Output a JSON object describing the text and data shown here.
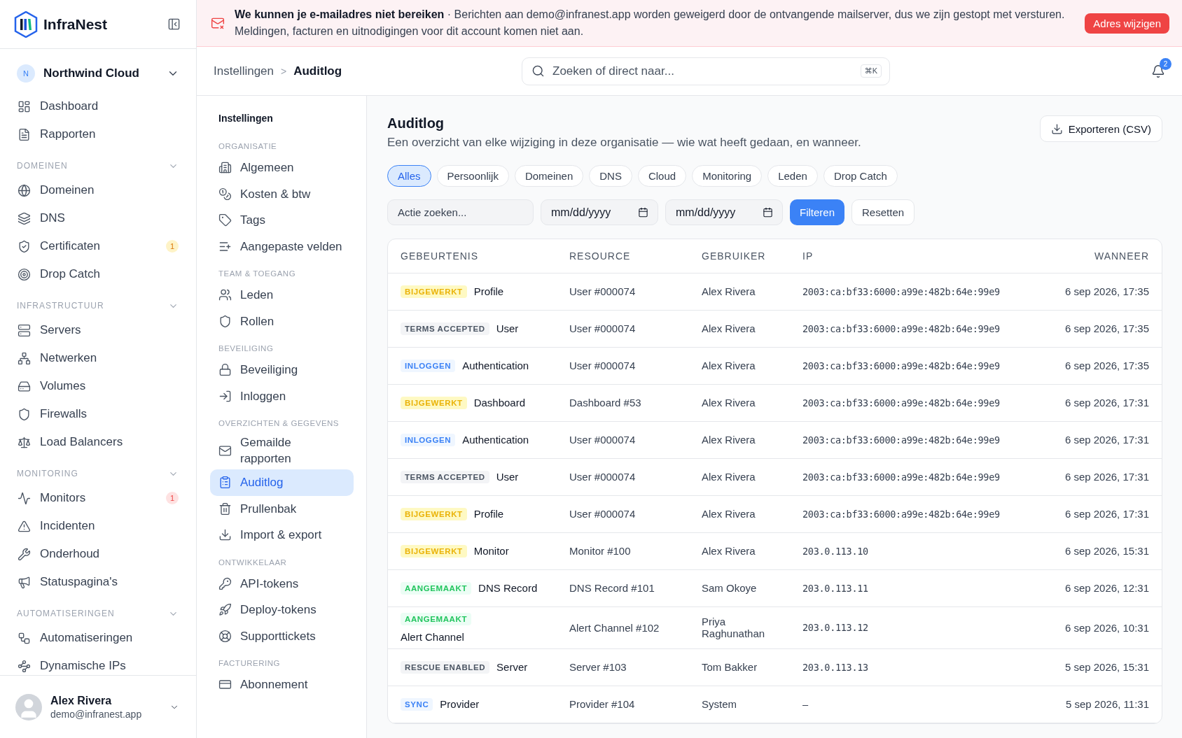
{
  "sidebar": {
    "brand": "InfraNest",
    "org": {
      "initial": "N",
      "name": "Northwind Cloud"
    },
    "top_items": [
      {
        "label": "Dashboard"
      },
      {
        "label": "Rapporten"
      }
    ],
    "sections": [
      {
        "title": "DOMEINEN",
        "items": [
          {
            "label": "Domeinen"
          },
          {
            "label": "DNS"
          },
          {
            "label": "Certificaten",
            "badge": "1",
            "kind": "warning"
          },
          {
            "label": "Drop Catch"
          }
        ]
      },
      {
        "title": "INFRASTRUCTUUR",
        "items": [
          {
            "label": "Servers"
          },
          {
            "label": "Netwerken"
          },
          {
            "label": "Volumes"
          },
          {
            "label": "Firewalls"
          },
          {
            "label": "Load Balancers"
          }
        ]
      },
      {
        "title": "MONITORING",
        "items": [
          {
            "label": "Monitors",
            "badge": "1",
            "kind": "danger"
          },
          {
            "label": "Incidenten"
          },
          {
            "label": "Onderhoud"
          },
          {
            "label": "Statuspagina's"
          }
        ]
      },
      {
        "title": "AUTOMATISERINGEN",
        "items": [
          {
            "label": "Automatiseringen"
          },
          {
            "label": "Dynamische IPs"
          }
        ]
      }
    ],
    "user": {
      "name": "Alex Rivera",
      "email": "demo@infranest.app"
    }
  },
  "banner": {
    "message": "**We kunnen je e-mailadres niet bereiken** · Berichten aan demo@infranest.app worden geweigerd door de ontvangende mailserver, dus we zijn gestopt met versturen. Meldingen, facturen en uitnodigingen voor dit account komen niet aan.",
    "button": "Adres wijzigen"
  },
  "header": {
    "breadcrumb": [
      "Instellingen",
      "Auditlog"
    ],
    "separator": ">",
    "search": {
      "placeholder": "Zoeken of direct naar...",
      "shortcut": "⌘K"
    },
    "notifications": "2"
  },
  "settings_nav": {
    "title": "Instellingen",
    "groups": [
      {
        "title": "ORGANISATIE",
        "items": [
          {
            "label": "Algemeen",
            "selected": false
          },
          {
            "label": "Kosten & btw",
            "selected": false
          },
          {
            "label": "Tags",
            "selected": false
          },
          {
            "label": "Aangepaste velden",
            "selected": false
          }
        ]
      },
      {
        "title": "TEAM & TOEGANG",
        "items": [
          {
            "label": "Leden",
            "selected": false
          },
          {
            "label": "Rollen",
            "selected": false
          }
        ]
      },
      {
        "title": "BEVEILIGING",
        "items": [
          {
            "label": "Beveiliging",
            "selected": false
          },
          {
            "label": "Inloggen",
            "selected": false
          }
        ]
      },
      {
        "title": "OVERZICHTEN & GEGEVENS",
        "items": [
          {
            "label": "Gemailde rapporten",
            "selected": false
          },
          {
            "label": "Auditlog",
            "selected": true
          },
          {
            "label": "Prullenbak",
            "selected": false
          },
          {
            "label": "Import & export",
            "selected": false
          }
        ]
      },
      {
        "title": "ONTWIKKELAAR",
        "items": [
          {
            "label": "API-tokens",
            "selected": false
          },
          {
            "label": "Deploy-tokens",
            "selected": false
          },
          {
            "label": "Supporttickets",
            "selected": false
          }
        ]
      },
      {
        "title": "FACTURERING",
        "items": [
          {
            "label": "Abonnement",
            "selected": false
          }
        ]
      }
    ]
  },
  "page": {
    "title": "Auditlog",
    "subtitle": "Een overzicht van elke wijziging in deze organisatie — wie wat heeft gedaan, en wanneer.",
    "export_button": "Exporteren (CSV)",
    "filters": [
      {
        "label": "Alles",
        "selected": true
      },
      {
        "label": "Persoonlijk",
        "selected": false
      },
      {
        "label": "Domeinen",
        "selected": false
      },
      {
        "label": "DNS",
        "selected": false
      },
      {
        "label": "Cloud",
        "selected": false
      },
      {
        "label": "Monitoring",
        "selected": false
      },
      {
        "label": "Leden",
        "selected": false
      },
      {
        "label": "Drop Catch",
        "selected": false
      }
    ],
    "search": {
      "placeholder": "Actie zoeken..."
    },
    "date_from": {
      "placeholder": "mm/dd/yyyy"
    },
    "date_to": {
      "placeholder": "mm/dd/yyyy"
    },
    "filter_button": "Filteren",
    "reset_button": "Resetten"
  },
  "table": {
    "columns": [
      "GEBEURTENIS",
      "RESOURCE",
      "GEBRUIKER",
      "IP",
      "WANNEER"
    ],
    "rows": [
      {
        "tag": "BIJGEWERKT",
        "kind": "updated",
        "event": "Profile",
        "resource": "User #000074",
        "user": "Alex Rivera",
        "ip": "2003:ca:bf33:6000:a99e:482b:64e:99e9",
        "when": "6 sep 2026, 17:35"
      },
      {
        "tag": "TERMS ACCEPTED",
        "kind": "neutral",
        "event": "User",
        "resource": "User #000074",
        "user": "Alex Rivera",
        "ip": "2003:ca:bf33:6000:a99e:482b:64e:99e9",
        "when": "6 sep 2026, 17:35"
      },
      {
        "tag": "INLOGGEN",
        "kind": "info",
        "event": "Authentication",
        "resource": "User #000074",
        "user": "Alex Rivera",
        "ip": "2003:ca:bf33:6000:a99e:482b:64e:99e9",
        "when": "6 sep 2026, 17:35"
      },
      {
        "tag": "BIJGEWERKT",
        "kind": "updated",
        "event": "Dashboard",
        "resource": "Dashboard #53",
        "user": "Alex Rivera",
        "ip": "2003:ca:bf33:6000:a99e:482b:64e:99e9",
        "when": "6 sep 2026, 17:31"
      },
      {
        "tag": "INLOGGEN",
        "kind": "info",
        "event": "Authentication",
        "resource": "User #000074",
        "user": "Alex Rivera",
        "ip": "2003:ca:bf33:6000:a99e:482b:64e:99e9",
        "when": "6 sep 2026, 17:31"
      },
      {
        "tag": "TERMS ACCEPTED",
        "kind": "neutral",
        "event": "User",
        "resource": "User #000074",
        "user": "Alex Rivera",
        "ip": "2003:ca:bf33:6000:a99e:482b:64e:99e9",
        "when": "6 sep 2026, 17:31"
      },
      {
        "tag": "BIJGEWERKT",
        "kind": "updated",
        "event": "Profile",
        "resource": "User #000074",
        "user": "Alex Rivera",
        "ip": "2003:ca:bf33:6000:a99e:482b:64e:99e9",
        "when": "6 sep 2026, 17:31"
      },
      {
        "tag": "BIJGEWERKT",
        "kind": "updated",
        "event": "Monitor",
        "resource": "Monitor #100",
        "user": "Alex Rivera",
        "ip": "203.0.113.10",
        "when": "6 sep 2026, 15:31"
      },
      {
        "tag": "AANGEMAAKT",
        "kind": "created",
        "event": "DNS Record",
        "resource": "DNS Record #101",
        "user": "Sam Okoye",
        "ip": "203.0.113.11",
        "when": "6 sep 2026, 12:31"
      },
      {
        "tag": "AANGEMAAKT",
        "kind": "created",
        "event": "Alert Channel",
        "resource": "Alert Channel #102",
        "user": "Priya Raghunathan",
        "ip": "203.0.113.12",
        "when": "6 sep 2026, 10:31"
      },
      {
        "tag": "RESCUE ENABLED",
        "kind": "neutral",
        "event": "Server",
        "resource": "Server #103",
        "user": "Tom Bakker",
        "ip": "203.0.113.13",
        "when": "5 sep 2026, 15:31"
      },
      {
        "tag": "SYNC",
        "kind": "info",
        "event": "Provider",
        "resource": "Provider #104",
        "user": "System",
        "ip": "–",
        "when": "5 sep 2026, 11:31"
      }
    ]
  }
}
